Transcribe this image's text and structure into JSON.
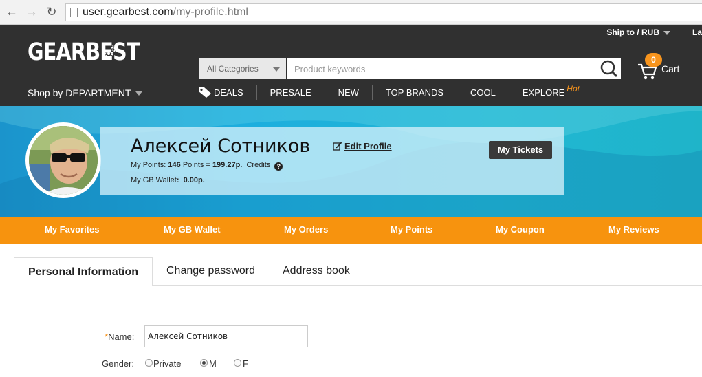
{
  "browser": {
    "url_domain": "user.gearbest.com",
    "url_path": "/my-profile.html"
  },
  "header": {
    "ship_to": "Ship to / RUB",
    "language_partial": "La",
    "logo_text": "GEARBEST",
    "department_label": "Shop by DEPARTMENT",
    "search": {
      "category": "All Categories",
      "placeholder": "Product keywords",
      "value": ""
    },
    "cart": {
      "count": "0",
      "label": "Cart"
    },
    "categories": [
      {
        "label": "DEALS"
      },
      {
        "label": "PRESALE"
      },
      {
        "label": "NEW"
      },
      {
        "label": "TOP BRANDS"
      },
      {
        "label": "COOL"
      },
      {
        "label": "EXPLORE"
      }
    ],
    "hot_badge": "Hot"
  },
  "profile": {
    "name": "Алексей Сотников",
    "edit_label": "Edit Profile",
    "points_prefix": "My Points: ",
    "points_value": "146",
    "points_mid": " Points = ",
    "points_money": "199.27p.",
    "credits_label": "Credits",
    "wallet_label": "My GB Wallet",
    "wallet_value": "0.00p.",
    "tickets_button": "My Tickets"
  },
  "account_nav": [
    {
      "label": "My Favorites"
    },
    {
      "label": "My GB Wallet"
    },
    {
      "label": "My Orders"
    },
    {
      "label": "My Points"
    },
    {
      "label": "My Coupon"
    },
    {
      "label": "My Reviews"
    }
  ],
  "tabs": [
    {
      "label": "Personal Information",
      "active": true
    },
    {
      "label": "Change password",
      "active": false
    },
    {
      "label": "Address book",
      "active": false
    }
  ],
  "form": {
    "name_required_mark": "*",
    "name_label": "Name:",
    "name_value": "Алексей Сотников",
    "gender_label": "Gender:",
    "gender_options": [
      {
        "label": "Private",
        "checked": false
      },
      {
        "label": "M",
        "checked": true
      },
      {
        "label": "F",
        "checked": false
      }
    ]
  },
  "colors": {
    "header_bg": "#303030",
    "accent_orange": "#f7930e",
    "banner_blue": "#1daede"
  }
}
